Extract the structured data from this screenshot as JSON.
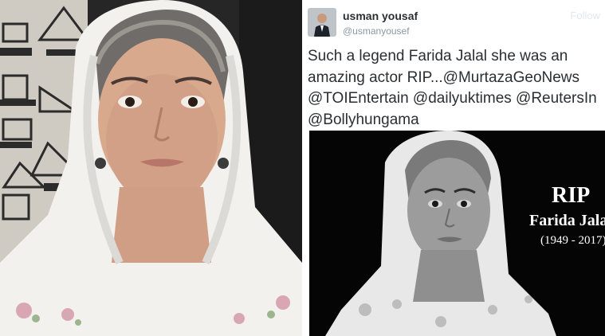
{
  "tweet": {
    "display_name": "usman yousaf",
    "handle": "@usmanyousef",
    "lines": [
      "Such a legend Farida Jalal she was an",
      "amazing actor RIP...@MurtazaGeoNews",
      "@TOIEntertain @dailyuktimes @ReutersIn",
      "@Bollyhungama"
    ],
    "follow_hint": "Follow"
  },
  "tweet_image": {
    "rip_title": "RIP",
    "rip_name": "Farida Jalal",
    "rip_years": "(1949 - 2017)"
  },
  "colors": {
    "name_text": "#292f33",
    "handle_text": "#8899a6",
    "image_background": "#050505"
  }
}
